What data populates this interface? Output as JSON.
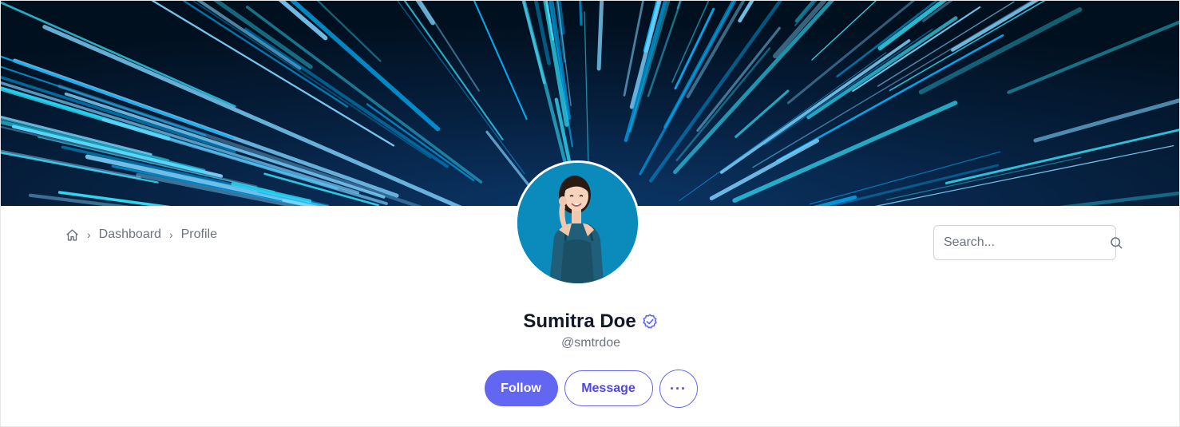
{
  "cover": {
    "image": "hyperspace-light-streaks",
    "colors": [
      "#021226",
      "#00b4ff",
      "#32e6ff",
      "#7fd4ff"
    ]
  },
  "breadcrumb": {
    "home_icon": "home-icon",
    "items": [
      "Dashboard",
      "Profile"
    ]
  },
  "search": {
    "placeholder": "Search...",
    "icon": "search-icon"
  },
  "profile": {
    "avatar": "profile-photo",
    "name": "Sumitra Doe",
    "verified_icon": "verified-badge-icon",
    "handle": "@smtrdoe"
  },
  "actions": {
    "follow": "Follow",
    "message": "Message",
    "more": "···"
  },
  "colors": {
    "accent": "#6366f1",
    "text": "#111827",
    "muted": "#6b7280"
  }
}
